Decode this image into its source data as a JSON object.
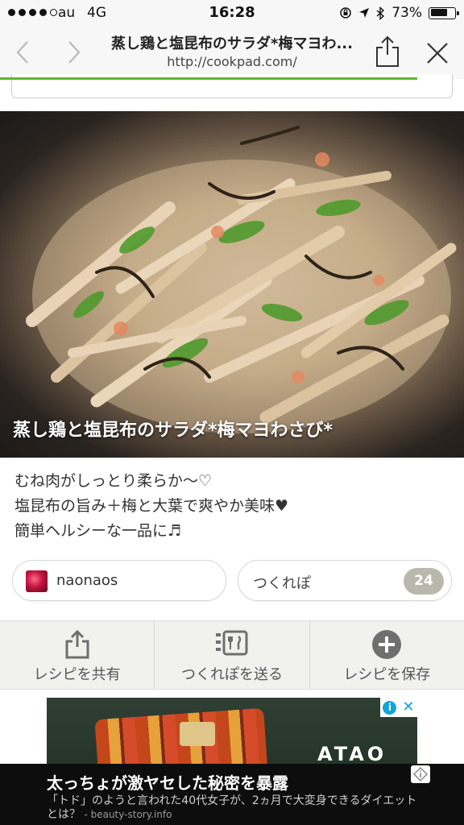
{
  "status_bar": {
    "carrier": "au",
    "network": "4G",
    "time": "16:28",
    "battery_percent": "73%",
    "battery_level": 0.73,
    "signal_bars": 4
  },
  "browser": {
    "page_title": "蒸し鶏と塩昆布のサラダ*梅マヨわ...",
    "url": "http://cookpad.com/",
    "load_progress": 0.9,
    "icons": [
      "back-icon",
      "forward-icon",
      "share-icon",
      "close-icon"
    ]
  },
  "recipe": {
    "title": "蒸し鶏と塩昆布のサラダ*梅マヨわさび*",
    "description": [
      "むね肉がしっとり柔らか〜♡",
      "塩昆布の旨み＋梅と大葉で爽やか美味♥",
      "簡単ヘルシーな一品に♬"
    ],
    "author": "naonaos",
    "tsukurepo_label": "つくれぽ",
    "tsukurepo_count": "24"
  },
  "actions": [
    {
      "label": "レシピを共有",
      "icon": "share-icon"
    },
    {
      "label": "つくれぽを送る",
      "icon": "tsukurepo-icon"
    },
    {
      "label": "レシピを保存",
      "icon": "plus-circle-icon"
    }
  ],
  "ad": {
    "brand": "ATAO",
    "info_icon": "info-icon",
    "close_icon": "close-icon"
  },
  "banner": {
    "headline": "太っちょが激ヤセした秘密を暴露",
    "text": "「トド」のようと言われた40代女子が、2ヵ月で大変身できるダイエットとは？",
    "source": "- beauty-story.info"
  },
  "colors": {
    "accent_green": "#5fb629",
    "count_badge": "#b9b8ac",
    "ad_info_blue": "#12a3d8"
  }
}
